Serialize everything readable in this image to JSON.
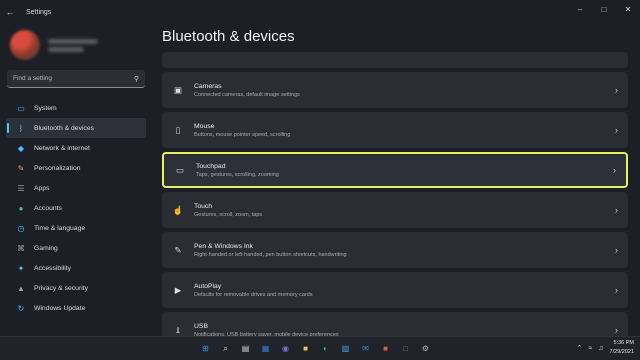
{
  "window": {
    "title": "Settings"
  },
  "search": {
    "placeholder": "Find a setting"
  },
  "sidebar": {
    "items": [
      {
        "label": "System",
        "icon": "monitor-icon",
        "color": "#4cc2ff"
      },
      {
        "label": "Bluetooth & devices",
        "icon": "bluetooth-icon",
        "color": "#4cc2ff",
        "active": true
      },
      {
        "label": "Network & internet",
        "icon": "wifi-icon",
        "color": "#4cc2ff"
      },
      {
        "label": "Personalization",
        "icon": "paintbrush-icon",
        "color": "#e8a33c"
      },
      {
        "label": "Apps",
        "icon": "apps-icon",
        "color": "#9aa0a6"
      },
      {
        "label": "Accounts",
        "icon": "person-icon",
        "color": "#3ec47a"
      },
      {
        "label": "Time & language",
        "icon": "globe-clock-icon",
        "color": "#4cc2ff"
      },
      {
        "label": "Gaming",
        "icon": "gamepad-icon",
        "color": "#9aa0a6"
      },
      {
        "label": "Accessibility",
        "icon": "accessibility-icon",
        "color": "#4cc2ff"
      },
      {
        "label": "Privacy & security",
        "icon": "shield-icon",
        "color": "#9aa0a6"
      },
      {
        "label": "Windows Update",
        "icon": "update-icon",
        "color": "#4cc2ff"
      }
    ]
  },
  "main": {
    "title": "Bluetooth & devices",
    "cards": [
      {
        "title": "Cameras",
        "desc": "Connected cameras, default image settings",
        "icon": "camera-icon"
      },
      {
        "title": "Mouse",
        "desc": "Buttons, mouse pointer speed, scrolling",
        "icon": "mouse-icon"
      },
      {
        "title": "Touchpad",
        "desc": "Taps, gestures, scrolling, zooming",
        "icon": "touchpad-icon",
        "selected": true
      },
      {
        "title": "Touch",
        "desc": "Gestures, scroll, zoom, taps",
        "icon": "touch-icon"
      },
      {
        "title": "Pen & Windows Ink",
        "desc": "Right-handed or left-handed, pen button shortcuts, handwriting",
        "icon": "pen-icon"
      },
      {
        "title": "AutoPlay",
        "desc": "Defaults for removable drives and memory cards",
        "icon": "autoplay-icon"
      },
      {
        "title": "USB",
        "desc": "Notifications, USB battery saver, mobile device preferences",
        "icon": "usb-icon"
      }
    ]
  },
  "taskbar": {
    "apps": [
      {
        "icon": "start-icon",
        "color": "#3a96dd"
      },
      {
        "icon": "search-icon",
        "color": "#dcdcdc"
      },
      {
        "icon": "task-view-icon",
        "color": "#dcdcdc"
      },
      {
        "icon": "widgets-icon",
        "color": "#3a7bd5"
      },
      {
        "icon": "teams-chat-icon",
        "color": "#7b6fd6"
      },
      {
        "icon": "file-explorer-icon",
        "color": "#f2c14e"
      },
      {
        "icon": "edge-icon",
        "color": "#2fb3a8"
      },
      {
        "icon": "store-icon",
        "color": "#4aa3df"
      },
      {
        "icon": "mail-icon",
        "color": "#3a8fe0"
      },
      {
        "icon": "office-icon",
        "color": "#e05a36"
      },
      {
        "icon": "unknown-app-icon",
        "color": "#8a8d94"
      },
      {
        "icon": "settings-icon",
        "color": "#b0b3b8"
      }
    ],
    "time": "5:36 PM",
    "date": "7/29/2021"
  }
}
